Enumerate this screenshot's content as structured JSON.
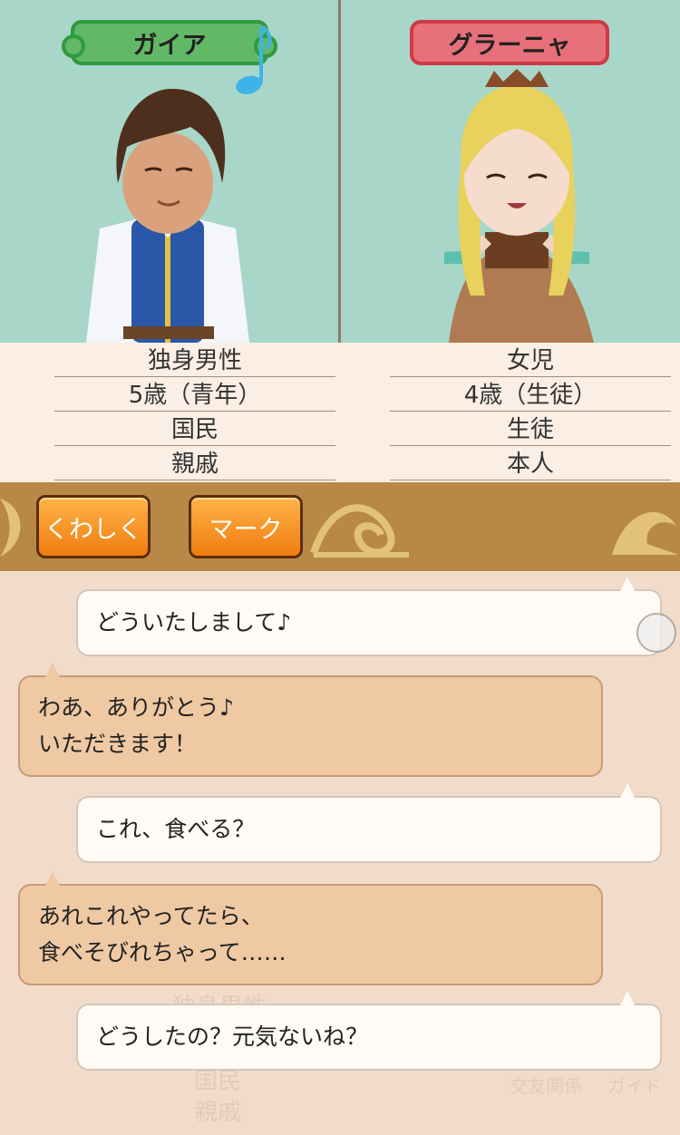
{
  "left_character": {
    "name": "ガイア",
    "info": [
      "独身男性",
      "5歳（青年）",
      "国民",
      "親戚"
    ]
  },
  "right_character": {
    "name": "グラーニャ",
    "info": [
      "女児",
      "4歳（生徒）",
      "生徒",
      "本人"
    ]
  },
  "buttons": {
    "details": "くわしく",
    "mark": "マーク"
  },
  "chat": [
    {
      "speaker": "left",
      "lines": [
        "どういたしまして♪"
      ]
    },
    {
      "speaker": "right",
      "lines": [
        "わあ、ありがとう♪",
        "いただきます！"
      ]
    },
    {
      "speaker": "left",
      "lines": [
        "これ、食べる？"
      ]
    },
    {
      "speaker": "right",
      "lines": [
        "あれこれやってたら、",
        "食べそびれちゃって……"
      ]
    },
    {
      "speaker": "left",
      "lines": [
        "どうしたの？元気ないね？"
      ]
    }
  ],
  "background_text": [
    "独身男性",
    "国民",
    "親戚",
    "交友関係",
    "ガイド"
  ],
  "colors": {
    "left_nameplate": "#62b866",
    "right_nameplate": "#e8707a",
    "panel_bg": "#a8d6c8",
    "button": "#f07c10"
  }
}
